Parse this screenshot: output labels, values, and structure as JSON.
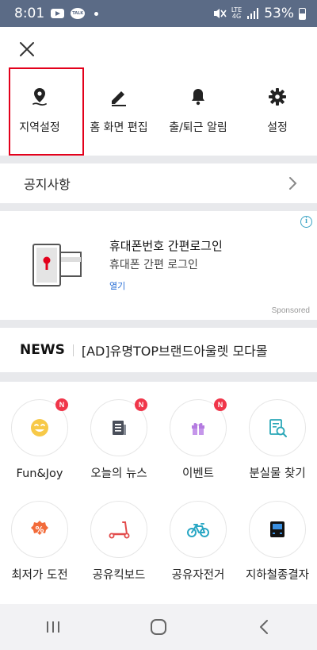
{
  "status_bar": {
    "time": "8:01",
    "app_icons": [
      "youtube-icon",
      "talk-icon",
      "dot-icon"
    ],
    "network": "LTE",
    "network_sub": "4G",
    "battery": "53%",
    "right_icons": [
      "mute-icon",
      "signal-icon",
      "battery-icon"
    ]
  },
  "close": {
    "icon": "close-icon"
  },
  "quick_menu": [
    {
      "label": "지역설정",
      "icon": "location-pin-icon"
    },
    {
      "label": "홈 화면 편집",
      "icon": "pencil-icon"
    },
    {
      "label": "출/퇴근 알림",
      "icon": "bell-icon"
    },
    {
      "label": "설정",
      "icon": "gear-icon"
    }
  ],
  "notice": {
    "label": "공지사항",
    "icon": "chevron-right-icon"
  },
  "ad": {
    "title": "휴대폰번호 간편로그인",
    "subtitle": "휴대폰 간편 로그인",
    "open_label": "열기",
    "sponsored": "Sponsored",
    "info_icon": "i",
    "accent_color": "#e3001b"
  },
  "news": {
    "label": "NEWS",
    "headline": "[AD]유명TOP브랜드아울렛 모다몰"
  },
  "grid": [
    {
      "label": "Fun&Joy",
      "icon": "smiley-icon",
      "badge": "N"
    },
    {
      "label": "오늘의 뉴스",
      "icon": "newspaper-icon",
      "badge": "N"
    },
    {
      "label": "이벤트",
      "icon": "gift-icon",
      "badge": "N"
    },
    {
      "label": "분실물 찾기",
      "icon": "lost-found-icon",
      "badge": ""
    },
    {
      "label": "최저가 도전",
      "icon": "percent-icon",
      "badge": ""
    },
    {
      "label": "공유킥보드",
      "icon": "kickboard-icon",
      "badge": ""
    },
    {
      "label": "공유자전거",
      "icon": "bicycle-icon",
      "badge": ""
    },
    {
      "label": "지하철종결자",
      "icon": "subway-icon",
      "badge": ""
    }
  ],
  "nav_bar": [
    {
      "icon": "recent-apps-icon"
    },
    {
      "icon": "home-icon"
    },
    {
      "icon": "back-icon"
    }
  ],
  "colors": {
    "status_bar": "#5b6b86",
    "highlight": "#e3001b",
    "badge": "#f0364a",
    "link": "#2a6fd6"
  }
}
